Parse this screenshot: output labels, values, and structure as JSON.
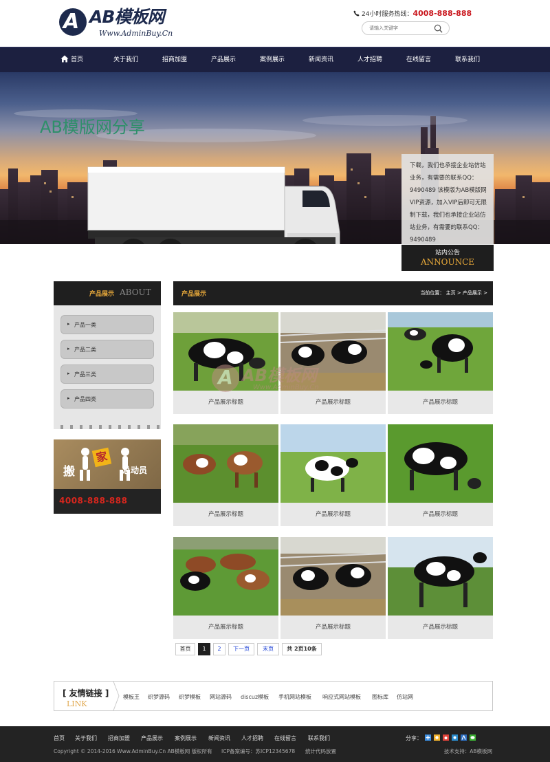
{
  "header": {
    "logo_title": "AB模板网",
    "logo_sub": "Www.AdminBuy.Cn",
    "logo_badge": "A",
    "hotline_label": "24小时服务热线：",
    "hotline_number": "4008-888-888",
    "search_placeholder": "请输入关键字"
  },
  "nav": {
    "items": [
      "首页",
      "关于我们",
      "招商加盟",
      "产品展示",
      "案例展示",
      "新闻资讯",
      "人才招聘",
      "在线留言",
      "联系我们"
    ]
  },
  "banner": {
    "truck_text": "AB模版网分享",
    "announce_text": "下载，我们也承接企业站仿站业务，有需要的联系QQ：9490489 该模版为AB模版网VIP资源，加入VIP后即可无限制下载，我们也承接企业站仿站业务，有需要的联系QQ：9490489",
    "announce_title": "站内公告",
    "announce_en": "ANNOUNCE"
  },
  "sidebar": {
    "title_cn": "产品展示",
    "title_en": "ABOUT",
    "items": [
      "产品一类",
      "产品二类",
      "产品三类",
      "产品四类"
    ],
    "arrow": "▸",
    "ad": {
      "word1": "搬",
      "box": "家",
      "slogan": "总动员",
      "phone": "4008-888-888"
    }
  },
  "main": {
    "title": "产品展示",
    "breadcrumb": "当前位置： 主页 > 产品展示 >",
    "products": [
      {
        "caption": "产品展示标题"
      },
      {
        "caption": "产品展示标题"
      },
      {
        "caption": "产品展示标题"
      },
      {
        "caption": "产品展示标题"
      },
      {
        "caption": "产品展示标题"
      },
      {
        "caption": "产品展示标题"
      },
      {
        "caption": "产品展示标题"
      },
      {
        "caption": "产品展示标题"
      },
      {
        "caption": "产品展示标题"
      }
    ],
    "watermark": {
      "badge": "A",
      "title": "AB模板网",
      "sub": "Www.AdminBuy.Cn"
    }
  },
  "pager": {
    "first": "首页",
    "page1": "1",
    "page2": "2",
    "next": "下一页",
    "last": "末页",
    "summary": "共 2页10条"
  },
  "links": {
    "title": "[ 友情链接 ]",
    "title_en": "LINK",
    "items": [
      "模板王",
      "织梦源码",
      "织梦模板",
      "网站源码",
      "discuz模板",
      "手机网站模板",
      "响应式网站模板",
      "图标库",
      "仿站网"
    ]
  },
  "footer": {
    "nav": [
      "首页",
      "关于我们",
      "招商加盟",
      "产品展示",
      "案例展示",
      "新闻资讯",
      "人才招聘",
      "在线留言",
      "联系我们"
    ],
    "share_label": "分享：",
    "copyright": "Copyright © 2014-2016 Www.AdminBuy.Cn AB模板网 版权所有",
    "icp": "ICP备案编号：苏ICP12345678",
    "stats": "统计代码放置",
    "support": "技术支持：AB模板网"
  }
}
